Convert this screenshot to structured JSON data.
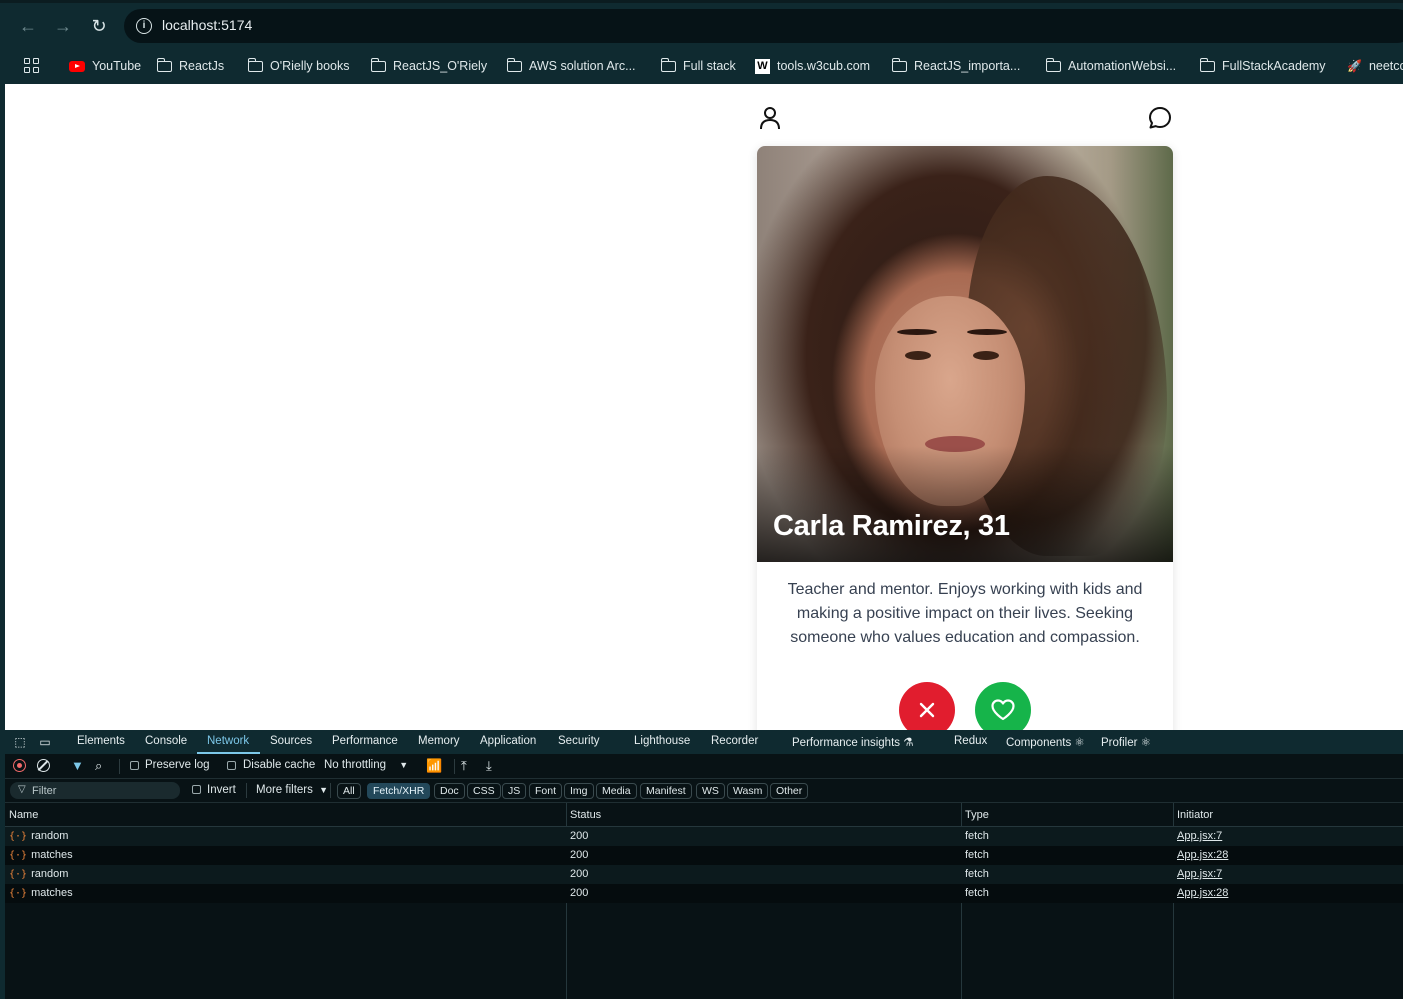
{
  "browser": {
    "url": "localhost:5174",
    "bookmarks": [
      {
        "label": "YouTube",
        "icon": "youtube-icon"
      },
      {
        "label": "ReactJs",
        "icon": "folder-icon"
      },
      {
        "label": "O'Rielly books",
        "icon": "folder-icon"
      },
      {
        "label": "ReactJS_O'Riely",
        "icon": "folder-icon"
      },
      {
        "label": "AWS solution Arc...",
        "icon": "folder-icon"
      },
      {
        "label": "Full stack",
        "icon": "folder-icon"
      },
      {
        "label": "tools.w3cub.com",
        "icon": "w3cub-icon"
      },
      {
        "label": "ReactJS_importa...",
        "icon": "folder-icon"
      },
      {
        "label": "AutomationWebsi...",
        "icon": "folder-icon"
      },
      {
        "label": "FullStackAcademy",
        "icon": "folder-icon"
      },
      {
        "label": "neetco",
        "icon": "rocket-icon"
      }
    ]
  },
  "profile": {
    "name_age": "Carla Ramirez, 31",
    "bio": "Teacher and mentor. Enjoys working with kids and making a positive impact on their lives. Seeking someone who values education and compassion."
  },
  "devtools": {
    "tabs": [
      "Elements",
      "Console",
      "Network",
      "Sources",
      "Performance",
      "Memory",
      "Application",
      "Security",
      "Lighthouse",
      "Recorder",
      "Performance insights",
      "Redux",
      "Components",
      "Profiler"
    ],
    "active_tab": "Network",
    "toolbar": {
      "preserve_log": "Preserve log",
      "disable_cache": "Disable cache",
      "throttling": "No throttling"
    },
    "filter": {
      "placeholder": "Filter",
      "invert": "Invert",
      "more_filters": "More filters",
      "types": [
        "All",
        "Fetch/XHR",
        "Doc",
        "CSS",
        "JS",
        "Font",
        "Img",
        "Media",
        "Manifest",
        "WS",
        "Wasm",
        "Other"
      ],
      "active_type": "Fetch/XHR"
    },
    "table": {
      "columns": [
        "Name",
        "Status",
        "Type",
        "Initiator"
      ],
      "rows": [
        {
          "name": "random",
          "status": "200",
          "type": "fetch",
          "initiator": "App.jsx:7"
        },
        {
          "name": "matches",
          "status": "200",
          "type": "fetch",
          "initiator": "App.jsx:28"
        },
        {
          "name": "random",
          "status": "200",
          "type": "fetch",
          "initiator": "App.jsx:7"
        },
        {
          "name": "matches",
          "status": "200",
          "type": "fetch",
          "initiator": "App.jsx:28"
        }
      ]
    }
  },
  "colors": {
    "reject": "#e11d2e",
    "like": "#16b44a",
    "devtools_accent": "#7cc7e8"
  }
}
